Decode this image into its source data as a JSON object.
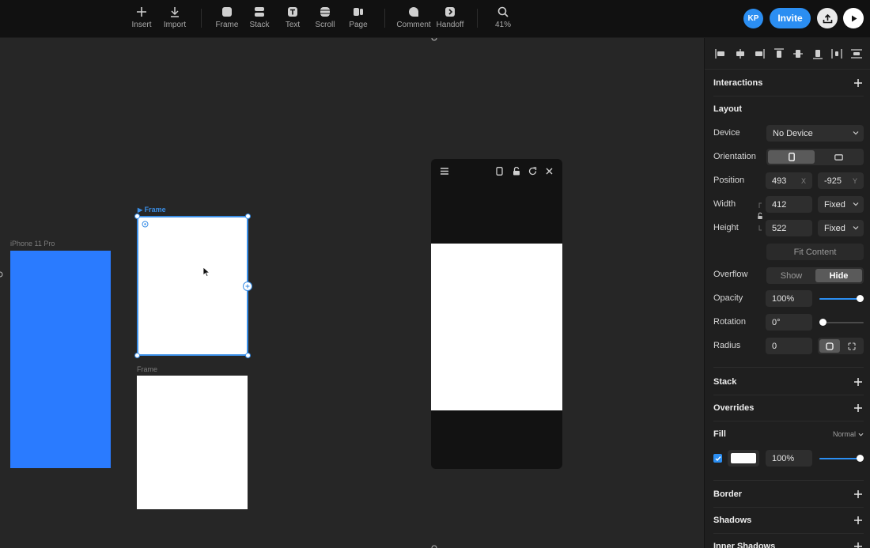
{
  "toolbar": {
    "tools": [
      {
        "label": "Insert",
        "icon": "plus-icon"
      },
      {
        "label": "Import",
        "icon": "download-icon"
      },
      {
        "label": "Frame",
        "icon": "frame-icon"
      },
      {
        "label": "Stack",
        "icon": "stack-icon"
      },
      {
        "label": "Text",
        "icon": "text-icon"
      },
      {
        "label": "Scroll",
        "icon": "scroll-icon"
      },
      {
        "label": "Page",
        "icon": "page-icon"
      },
      {
        "label": "Comment",
        "icon": "comment-icon"
      },
      {
        "label": "Handoff",
        "icon": "handoff-icon"
      },
      {
        "label": "41%",
        "icon": "zoom-icon"
      }
    ],
    "avatar_initials": "KP",
    "invite_label": "Invite"
  },
  "canvas": {
    "iphone_label": "iPhone 11 Pro",
    "iphone_color": "#2a7bff",
    "selected_frame_label": "Frame",
    "second_frame_label": "Frame"
  },
  "panel": {
    "interactions": "Interactions",
    "layout": "Layout",
    "device_label": "Device",
    "device_value": "No Device",
    "orientation_label": "Orientation",
    "position_label": "Position",
    "position_x": "493",
    "position_x_suffix": "X",
    "position_y": "-925",
    "position_y_suffix": "Y",
    "width_label": "Width",
    "width_value": "412",
    "width_mode": "Fixed",
    "height_label": "Height",
    "height_value": "522",
    "height_mode": "Fixed",
    "fit_content": "Fit Content",
    "overflow_label": "Overflow",
    "overflow_show": "Show",
    "overflow_hide": "Hide",
    "opacity_label": "Opacity",
    "opacity_value": "100%",
    "opacity_level": 1.0,
    "rotation_label": "Rotation",
    "rotation_value": "0°",
    "rotation_level": 0.0,
    "radius_label": "Radius",
    "radius_value": "0",
    "stack": "Stack",
    "overrides": "Overrides",
    "fill": "Fill",
    "fill_blend": "Normal",
    "fill_color": "#ffffff",
    "fill_opacity": "100%",
    "fill_level": 1.0,
    "border": "Border",
    "shadows": "Shadows",
    "inner_shadows": "Inner Shadows"
  },
  "accent": "#2b8ef2"
}
